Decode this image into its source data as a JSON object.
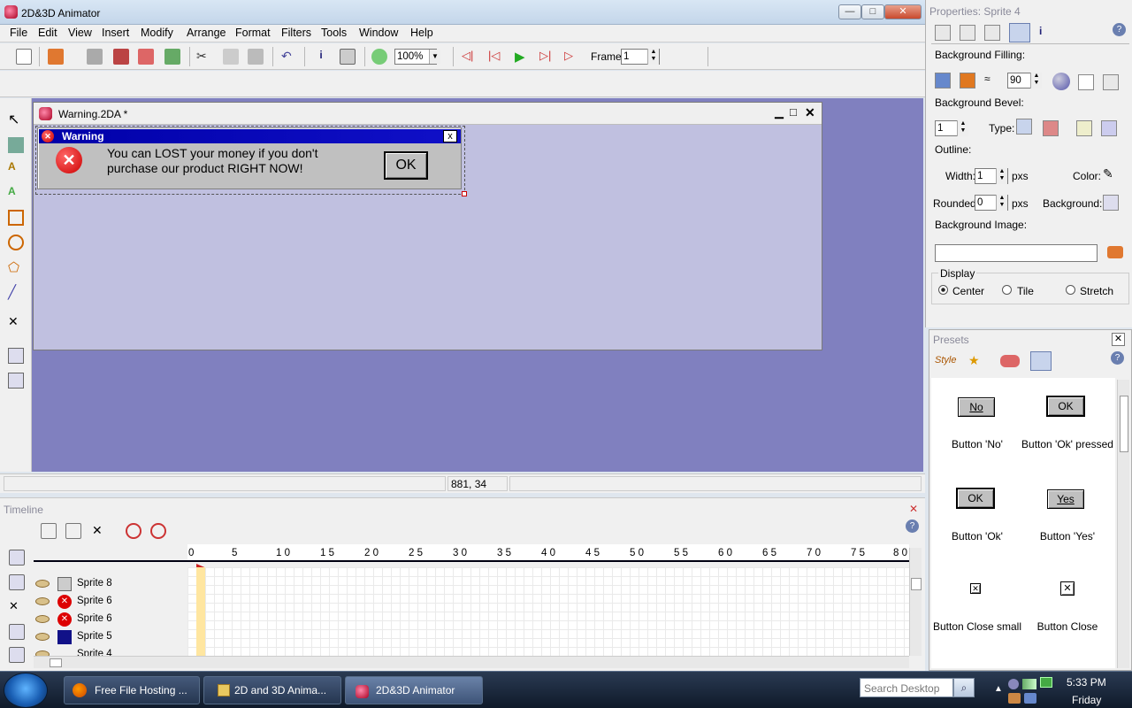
{
  "app": {
    "title": "2D&3D Animator",
    "controls": {
      "minimize": "—",
      "maximize": "□",
      "close": "✕"
    }
  },
  "menu": [
    "File",
    "Edit",
    "View",
    "Insert",
    "Modify",
    "Arrange",
    "Format",
    "Filters",
    "Tools",
    "Window",
    "Help"
  ],
  "toolbar": {
    "zoom": "100%",
    "frame_label": "Frame:",
    "frame_value": "1"
  },
  "document": {
    "title": "Warning.2DA *"
  },
  "dialog": {
    "title": "Warning",
    "message_line1": "You can LOST your money if you don't",
    "message_line2": "purchase our product RIGHT NOW!",
    "ok": "OK",
    "close_glyph": "x"
  },
  "status": {
    "coords": "881, 34"
  },
  "properties": {
    "title": "Properties: Sprite 4",
    "background_filling": "Background Filling:",
    "angle_value": "90",
    "background_bevel": "Background Bevel:",
    "bevel_value": "1",
    "type_label": "Type:",
    "outline": "Outline:",
    "width_label": "Width:",
    "width_value": "1",
    "px": "pxs",
    "color_label": "Color:",
    "rounded_label": "Rounded:",
    "rounded_value": "0",
    "background_label": "Background:",
    "background_image": "Background Image:",
    "display": "Display",
    "display_options": [
      "Center",
      "Tile",
      "Stretch"
    ],
    "display_selected": "Center"
  },
  "presets": {
    "title": "Presets",
    "items": [
      {
        "button_text": "No",
        "caption": "Button 'No'"
      },
      {
        "button_text": "OK",
        "caption": "Button 'Ok' pressed"
      },
      {
        "button_text": "OK",
        "caption": "Button 'Ok'"
      },
      {
        "button_text": "Yes",
        "caption": "Button 'Yes'"
      },
      {
        "button_text": "✕",
        "caption": "Button Close small"
      },
      {
        "button_text": "✕",
        "caption": "Button Close"
      }
    ]
  },
  "timeline": {
    "title": "Timeline",
    "ticks": [
      "0",
      "5",
      "1 0",
      "1 5",
      "2 0",
      "2 5",
      "3 0",
      "3 5",
      "4 0",
      "4 5",
      "5 0",
      "5 5",
      "6 0",
      "6 5",
      "7 0",
      "7 5",
      "8 0"
    ],
    "layers": [
      "Sprite 8",
      "Sprite 6",
      "Sprite 6",
      "Sprite 5",
      "Sprite 4"
    ]
  },
  "taskbar": {
    "tasks": [
      "Free File Hosting ...",
      "2D and 3D Anima...",
      "2D&3D Animator"
    ],
    "search_placeholder": "Search Desktop",
    "time": "5:33 PM",
    "day": "Friday"
  },
  "colors": {
    "canvas": "#8080bf",
    "document": "#c0c0e0",
    "dialog_title": "#0000a8"
  }
}
